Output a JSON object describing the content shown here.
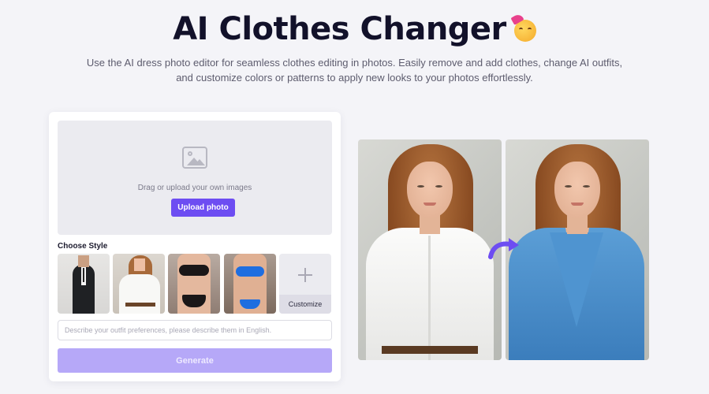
{
  "hero": {
    "title": "AI Clothes Changer",
    "emoji_icon": "partying-face-icon",
    "subtitle": "Use the AI dress photo editor for seamless clothes editing in photos. Easily remove and add clothes, change AI outfits, and customize colors or patterns to apply new looks to your photos effortlessly."
  },
  "uploader": {
    "icon": "image-placeholder-icon",
    "drop_text": "Drag or upload your own images",
    "upload_label": "Upload photo"
  },
  "styles": {
    "label": "Choose Style",
    "options": [
      {
        "name": "black-suit"
      },
      {
        "name": "white-shirt"
      },
      {
        "name": "black-lace-lingerie"
      },
      {
        "name": "blue-bikini"
      }
    ],
    "customize_label": "Customize"
  },
  "prompt": {
    "placeholder": "Describe your outfit preferences, please describe them in English.",
    "value": ""
  },
  "generate_label": "Generate",
  "preview": {
    "arrow_icon": "curved-arrow-right-icon"
  },
  "colors": {
    "accent": "#6d4df2",
    "accent_disabled": "#b6a8f8",
    "background": "#f4f4f8"
  }
}
